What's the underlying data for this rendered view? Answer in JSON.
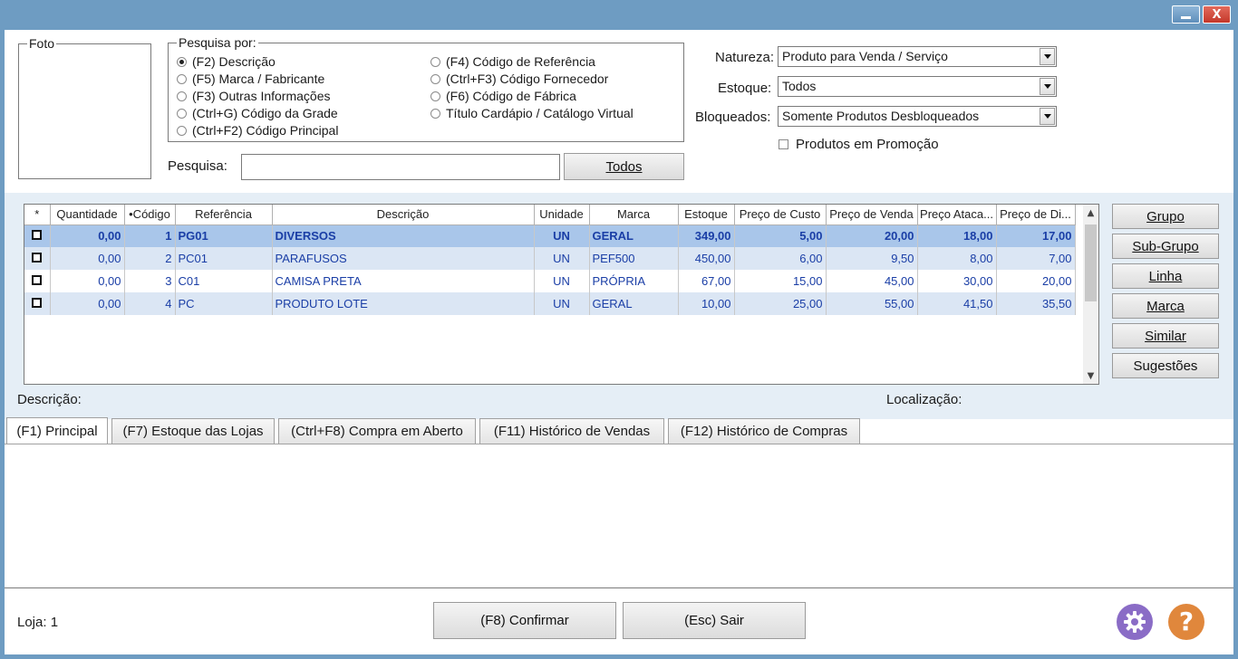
{
  "window": {
    "minimize_label": "",
    "close_label": "X"
  },
  "foto": {
    "legend": "Foto"
  },
  "pesquisa_por": {
    "legend": "Pesquisa por:",
    "options": [
      {
        "label": "(F2) Descrição",
        "selected": true
      },
      {
        "label": "(F5) Marca / Fabricante",
        "selected": false
      },
      {
        "label": "(F3) Outras Informações",
        "selected": false
      },
      {
        "label": "(Ctrl+G) Código da Grade",
        "selected": false
      },
      {
        "label": "(Ctrl+F2) Código Principal",
        "selected": false
      },
      {
        "label": "(F4) Código de Referência",
        "selected": false
      },
      {
        "label": "(Ctrl+F3) Código Fornecedor",
        "selected": false
      },
      {
        "label": "(F6) Código de Fábrica",
        "selected": false
      },
      {
        "label": "Título Cardápio / Catálogo Virtual",
        "selected": false
      }
    ]
  },
  "search": {
    "label": "Pesquisa:",
    "value": "",
    "todos_label": "Todos"
  },
  "filters": {
    "natureza_label": "Natureza:",
    "natureza_value": "Produto para Venda / Serviço",
    "estoque_label": "Estoque:",
    "estoque_value": "Todos",
    "bloqueados_label": "Bloqueados:",
    "bloqueados_value": "Somente Produtos Desbloqueados",
    "promocao_label": "Produtos em Promoção",
    "promocao_checked": false
  },
  "grid": {
    "columns": [
      "*",
      "Quantidade",
      "•Código",
      "Referência",
      "Descrição",
      "Unidade",
      "Marca",
      "Estoque",
      "Preço de Custo",
      "Preço de Venda",
      "Preço Ataca...",
      "Preço de Di..."
    ],
    "rows": [
      {
        "quantidade": "0,00",
        "codigo": "1",
        "referencia": "PG01",
        "descricao": "DIVERSOS",
        "unidade": "UN",
        "marca": "GERAL",
        "estoque": "349,00",
        "custo": "5,00",
        "venda": "20,00",
        "atacado": "18,00",
        "dist": "17,00"
      },
      {
        "quantidade": "0,00",
        "codigo": "2",
        "referencia": "PC01",
        "descricao": "PARAFUSOS",
        "unidade": "UN",
        "marca": "PEF500",
        "estoque": "450,00",
        "custo": "6,00",
        "venda": "9,50",
        "atacado": "8,00",
        "dist": "7,00"
      },
      {
        "quantidade": "0,00",
        "codigo": "3",
        "referencia": "C01",
        "descricao": "CAMISA PRETA",
        "unidade": "UN",
        "marca": "PRÓPRIA",
        "estoque": "67,00",
        "custo": "15,00",
        "venda": "45,00",
        "atacado": "30,00",
        "dist": "20,00"
      },
      {
        "quantidade": "0,00",
        "codigo": "4",
        "referencia": "PC",
        "descricao": "PRODUTO LOTE",
        "unidade": "UN",
        "marca": "GERAL",
        "estoque": "10,00",
        "custo": "25,00",
        "venda": "55,00",
        "atacado": "41,50",
        "dist": "35,50"
      }
    ]
  },
  "side_buttons": {
    "grupo": "Grupo",
    "subgrupo": "Sub-Grupo",
    "linha": "Linha",
    "marca": "Marca",
    "similar": "Similar",
    "sugestoes": "Sugestões"
  },
  "detail": {
    "descricao_label": "Descrição:",
    "localizacao_label": "Localização:"
  },
  "tabs": [
    {
      "label": "(F1) Principal",
      "active": true
    },
    {
      "label": "(F7) Estoque das Lojas",
      "active": false
    },
    {
      "label": "(Ctrl+F8) Compra em Aberto",
      "active": false
    },
    {
      "label": "(F11) Histórico de Vendas",
      "active": false
    },
    {
      "label": "(F12) Histórico de Compras",
      "active": false
    }
  ],
  "footer": {
    "loja_label": "Loja: 1",
    "confirmar_label": "(F8) Confirmar",
    "sair_label": "(Esc) Sair"
  },
  "icons": {
    "settings": "gear-icon",
    "help": "help-icon"
  },
  "colors": {
    "frame": "#6e9cc2",
    "band": "#e5eef6",
    "selected_row": "#a9c6ea",
    "alt_row": "#dbe6f4",
    "grid_text": "#1a3ea6",
    "icon_purple": "#8a6cc6",
    "icon_orange": "#e0873c"
  }
}
